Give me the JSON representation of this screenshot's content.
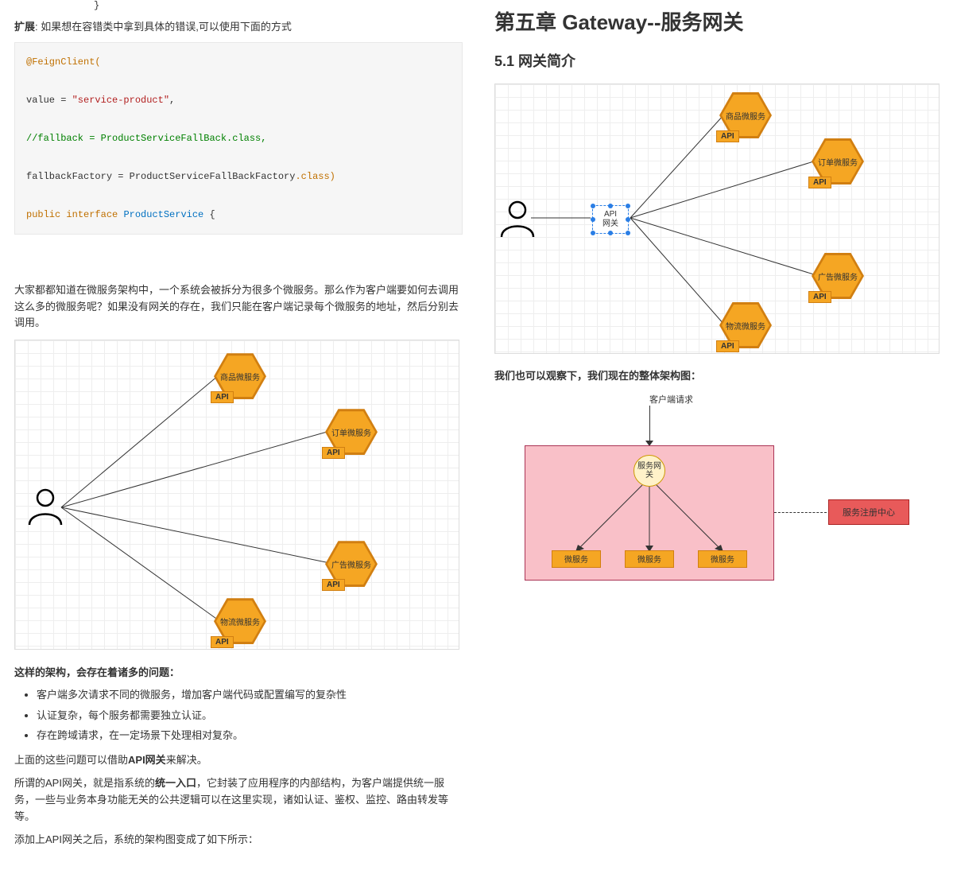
{
  "left": {
    "pre_top": "}",
    "expand_label": "扩展",
    "expand_text": ": 如果想在容错类中拿到具体的错误,可以使用下面的方式",
    "code": {
      "annotation": "@FeignClient(",
      "line2a": "value = ",
      "line2b": "\"service-product\"",
      "line2c": ",",
      "line3a": "//fallback = ProductServiceFallBack.class,",
      "line4a": "fallbackFactory = ProductServiceFallBackFactory",
      "line4b": ".class)",
      "line5a": "public",
      "line5b": " interface ",
      "line5c": "ProductService",
      "line5d": " {"
    },
    "intro_para": "大家都都知道在微服务架构中，一个系统会被拆分为很多个微服务。那么作为客户端要如何去调用这么多的微服务呢？如果没有网关的存在，我们只能在客户端记录每个微服务的地址，然后分别去调用。",
    "hex_labels": {
      "product": "商品微服务",
      "order": "订单微服务",
      "ad": "广告微服务",
      "logistics": "物流微服务",
      "api_tag": "API"
    },
    "issues_head": "这样的架构，会存在着诸多的问题：",
    "issues": [
      "客户端多次请求不同的微服务，增加客户端代码或配置编写的复杂性",
      "认证复杂，每个服务都需要独立认证。",
      "存在跨域请求，在一定场景下处理相对复杂。"
    ],
    "solve_para_a": "上面的这些问题可以借助",
    "solve_para_b": "API网关",
    "solve_para_c": "来解决。",
    "api_gw_para_a": "所谓的API网关，就是指系统的",
    "api_gw_para_b": "统一入口",
    "api_gw_para_c": "，它封装了应用程序的内部结构，为客户端提供统一服务，一些与业务本身功能无关的公共逻辑可以在这里实现，诸如认证、鉴权、监控、路由转发等等。",
    "after_add": "添加上API网关之后，系统的架构图变成了如下所示："
  },
  "right": {
    "h1": "第五章 Gateway--服务网关",
    "h2": "5.1 网关简介",
    "gw_box_line1": "API",
    "gw_box_line2": "网关",
    "observe": "我们也可以观察下，我们现在的整体架构图：",
    "arch": {
      "client_req": "客户端请求",
      "gw_circle": "服务网关",
      "svc": "微服务",
      "registry": "服务注册中心"
    }
  }
}
